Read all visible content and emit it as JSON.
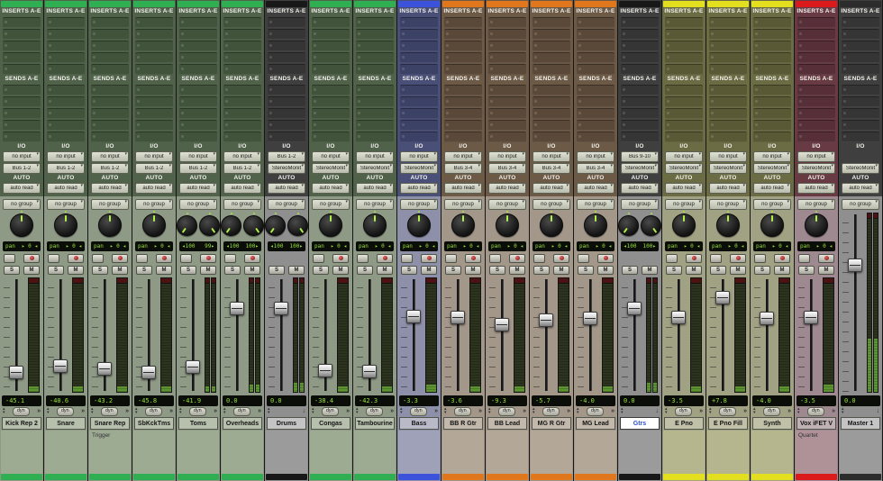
{
  "labels": {
    "inserts": "INSERTS A-E",
    "sends": "SENDS A-E",
    "io": "I/O",
    "auto": "AUTO",
    "auto_mode": "auto read",
    "group": "no group",
    "pan_label": "pan",
    "solo": "S",
    "mute": "M",
    "dyn": "dyn",
    "mono_pan_value": "0",
    "expand_glyph": "»",
    "collapse_glyph": "↓"
  },
  "palettes": {
    "green": {
      "bar": "#2fae52",
      "body": "#50624a",
      "slot": "#41533b",
      "lower": "#8e9a85",
      "comments": "#9eab93",
      "name": "#b7bfad"
    },
    "dark": {
      "bar": "#181818",
      "body": "#3f3f3f",
      "slot": "#353535",
      "lower": "#8f8f8f",
      "comments": "#9b9b9b",
      "name": "#c4c4c4"
    },
    "blue": {
      "bar": "#3c52da",
      "body": "#4a4f78",
      "slot": "#3c4166",
      "lower": "#8d90a8",
      "comments": "#9ea1b7",
      "name": "#b8bac7"
    },
    "brown": {
      "bar": "#e0771d",
      "body": "#6c5946",
      "slot": "#5a4938",
      "lower": "#a3978a",
      "comments": "#b3a797",
      "name": "#c2b8ab"
    },
    "olive": {
      "bar": "#e3df1f",
      "body": "#6b6b44",
      "slot": "#595936",
      "lower": "#a1a184",
      "comments": "#b5b58e",
      "name": "#c1c1a9"
    },
    "red": {
      "bar": "#db1a1c",
      "body": "#683a43",
      "slot": "#562f38",
      "lower": "#9f8990",
      "comments": "#ae9298",
      "name": "#c0b1b5"
    },
    "master": {
      "bar": "#2c2c2c",
      "body": "#3f3f3f",
      "slot": "#353535",
      "lower": "#8f8f8f",
      "comments": "#9b9b9b",
      "name": "#c4c4c4"
    }
  },
  "display_colors": {
    "readout_green": "#96e23c",
    "display_bg": "#0b0d09",
    "selected_name_text": "#2b50cc"
  },
  "strips": [
    {
      "name": "Kick Rep 2",
      "palette": "green",
      "kind": "audio",
      "stereo": false,
      "input": "no input",
      "output": "Bus 1-2",
      "auto": "auto read",
      "group": "no group",
      "pan": {
        "type": "mono",
        "value": "0"
      },
      "vol": "-45.1",
      "cap": 0.86,
      "meter_lit": 0.05,
      "comment": "",
      "selected": false
    },
    {
      "name": "Snare",
      "palette": "green",
      "kind": "audio",
      "stereo": false,
      "input": "no input",
      "output": "Bus 1-2",
      "auto": "auto read",
      "group": "no group",
      "pan": {
        "type": "mono",
        "value": "0"
      },
      "vol": "-40.6",
      "cap": 0.8,
      "meter_lit": 0.05,
      "comment": "",
      "selected": false
    },
    {
      "name": "Snare Rep",
      "palette": "green",
      "kind": "audio",
      "stereo": false,
      "input": "no input",
      "output": "Bus 1-2",
      "auto": "auto read",
      "group": "no group",
      "pan": {
        "type": "mono",
        "value": "0"
      },
      "vol": "-43.2",
      "cap": 0.83,
      "meter_lit": 0.05,
      "comment": "Trigger",
      "selected": false
    },
    {
      "name": "SbKckTms",
      "palette": "green",
      "kind": "audio",
      "stereo": false,
      "input": "no input",
      "output": "Bus 1-2",
      "auto": "auto read",
      "group": "no group",
      "pan": {
        "type": "mono",
        "value": "0"
      },
      "vol": "-45.8",
      "cap": 0.86,
      "meter_lit": 0.05,
      "comment": "",
      "selected": false
    },
    {
      "name": "Toms",
      "palette": "green",
      "kind": "audio",
      "stereo": true,
      "input": "no input",
      "output": "Bus 1-2",
      "auto": "auto read",
      "group": "no group",
      "pan": {
        "type": "stereo",
        "left": "100",
        "right": "99"
      },
      "vol": "-41.9",
      "cap": 0.81,
      "meter_lit": 0.05,
      "comment": "",
      "selected": false
    },
    {
      "name": "Overheads",
      "palette": "green",
      "kind": "audio",
      "stereo": true,
      "input": "no input",
      "output": "Bus 1-2",
      "auto": "auto read",
      "group": "no group",
      "pan": {
        "type": "stereo",
        "left": "100",
        "right": "100"
      },
      "vol": "0.0",
      "cap": 0.24,
      "meter_lit": 0.06,
      "comment": "",
      "selected": false
    },
    {
      "name": "Drums",
      "palette": "dark",
      "kind": "aux",
      "stereo": true,
      "input": "Bus 1-2",
      "output": "StereoMonit",
      "auto": "auto read",
      "group": "no group",
      "pan": {
        "type": "stereo",
        "left": "100",
        "right": "100"
      },
      "vol": "0.0",
      "cap": 0.24,
      "meter_lit": 0.08,
      "comment": "",
      "selected": false
    },
    {
      "name": "Congas",
      "palette": "green",
      "kind": "audio",
      "stereo": false,
      "input": "no input",
      "output": "StereoMonit",
      "auto": "auto read",
      "group": "no group",
      "pan": {
        "type": "mono",
        "value": "0"
      },
      "vol": "-38.4",
      "cap": 0.84,
      "meter_lit": 0.05,
      "comment": "",
      "selected": false
    },
    {
      "name": "Tambourine",
      "palette": "green",
      "kind": "audio",
      "stereo": false,
      "input": "no input",
      "output": "StereoMonit",
      "auto": "auto read",
      "group": "no group",
      "pan": {
        "type": "mono",
        "value": "0"
      },
      "vol": "-42.3",
      "cap": 0.85,
      "meter_lit": 0.05,
      "comment": "",
      "selected": false
    },
    {
      "name": "Bass",
      "palette": "blue",
      "kind": "audio",
      "stereo": false,
      "input": "no input",
      "output": "StereoMonit",
      "auto": "auto read",
      "group": "no group",
      "pan": {
        "type": "mono",
        "value": "0"
      },
      "vol": "-3.3",
      "cap": 0.32,
      "meter_lit": 0.06,
      "comment": "",
      "selected": false
    },
    {
      "name": "BB R Gtr",
      "palette": "brown",
      "kind": "audio",
      "stereo": false,
      "input": "no input",
      "output": "Bus 3-4",
      "auto": "auto read",
      "group": "no group",
      "pan": {
        "type": "mono",
        "value": "0"
      },
      "vol": "-3.6",
      "cap": 0.33,
      "meter_lit": 0.05,
      "comment": "",
      "selected": false
    },
    {
      "name": "BB Lead",
      "palette": "brown",
      "kind": "audio",
      "stereo": false,
      "input": "no input",
      "output": "Bus 3-4",
      "auto": "auto read",
      "group": "no group",
      "pan": {
        "type": "mono",
        "value": "0"
      },
      "vol": "-9.3",
      "cap": 0.4,
      "meter_lit": 0.05,
      "comment": "",
      "selected": false
    },
    {
      "name": "MG R Gtr",
      "palette": "brown",
      "kind": "audio",
      "stereo": false,
      "input": "no input",
      "output": "Bus 3-4",
      "auto": "auto read",
      "group": "no group",
      "pan": {
        "type": "mono",
        "value": "0"
      },
      "vol": "-5.7",
      "cap": 0.36,
      "meter_lit": 0.05,
      "comment": "",
      "selected": false
    },
    {
      "name": "MG Lead",
      "palette": "brown",
      "kind": "audio",
      "stereo": false,
      "input": "no input",
      "output": "Bus 3-4",
      "auto": "auto read",
      "group": "no group",
      "pan": {
        "type": "mono",
        "value": "0"
      },
      "vol": "-4.0",
      "cap": 0.34,
      "meter_lit": 0.05,
      "comment": "",
      "selected": false
    },
    {
      "name": "Gtrs",
      "palette": "dark",
      "kind": "aux",
      "stereo": true,
      "input": "Bus 9-10",
      "output": "StereoMonit",
      "auto": "auto read",
      "group": "no group",
      "pan": {
        "type": "stereo",
        "left": "100",
        "right": "100"
      },
      "vol": "0.0",
      "cap": 0.24,
      "meter_lit": 0.08,
      "comment": "",
      "selected": true
    },
    {
      "name": "E Pno",
      "palette": "olive",
      "kind": "audio",
      "stereo": false,
      "input": "no input",
      "output": "StereoMonit",
      "auto": "auto read",
      "group": "no group",
      "pan": {
        "type": "mono",
        "value": "0"
      },
      "vol": "-3.5",
      "cap": 0.33,
      "meter_lit": 0.05,
      "comment": "",
      "selected": false
    },
    {
      "name": "E Pno Fill",
      "palette": "olive",
      "kind": "audio",
      "stereo": false,
      "input": "no input",
      "output": "StereoMonit",
      "auto": "auto read",
      "group": "no group",
      "pan": {
        "type": "mono",
        "value": "0"
      },
      "vol": "+7.8",
      "cap": 0.14,
      "meter_lit": 0.05,
      "comment": "",
      "selected": false
    },
    {
      "name": "Synth",
      "palette": "olive",
      "kind": "audio",
      "stereo": false,
      "input": "no input",
      "output": "StereoMonit",
      "auto": "auto read",
      "group": "no group",
      "pan": {
        "type": "mono",
        "value": "0"
      },
      "vol": "-4.0",
      "cap": 0.34,
      "meter_lit": 0.05,
      "comment": "",
      "selected": false
    },
    {
      "name": "Vox iFET V",
      "palette": "red",
      "kind": "audio",
      "stereo": false,
      "input": "no input",
      "output": "StereoMonit",
      "auto": "auto read",
      "group": "no group",
      "pan": {
        "type": "mono",
        "value": "0"
      },
      "vol": "-3.5",
      "cap": 0.33,
      "meter_lit": 0.06,
      "comment": "Quartet",
      "selected": false
    },
    {
      "name": "Master 1",
      "palette": "master",
      "kind": "master",
      "stereo": true,
      "input": null,
      "output": "StereoMonit",
      "auto": "auto read",
      "group": "no group",
      "pan": null,
      "vol": "0.0",
      "cap": 0.28,
      "meter_lit": 0.3,
      "comment": "",
      "selected": false
    }
  ]
}
